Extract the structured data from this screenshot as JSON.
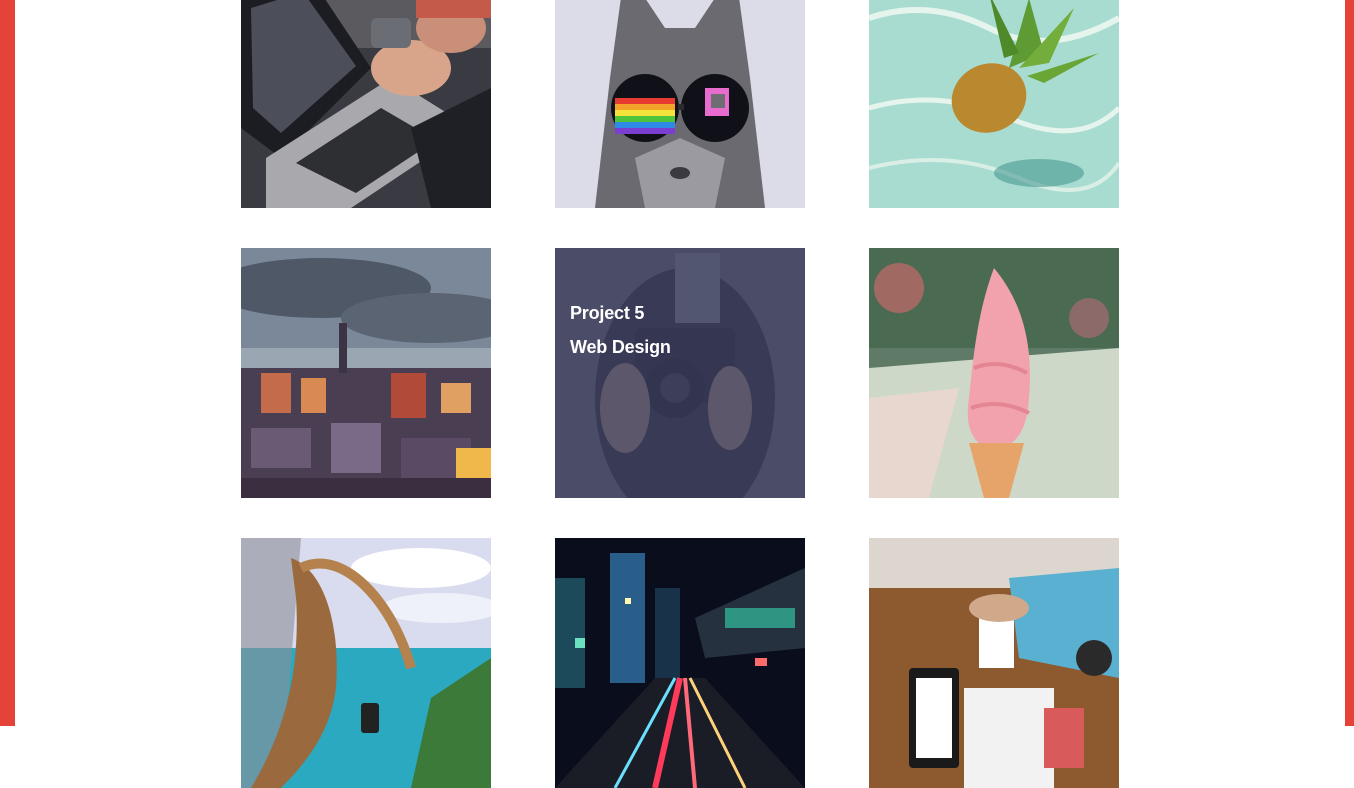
{
  "colors": {
    "frame": "#e5433a",
    "background": "#ffffff",
    "overlay": "#3e4060"
  },
  "portfolio": {
    "tiles": [
      {
        "subject": "laptop"
      },
      {
        "subject": "cat-with-sunglasses"
      },
      {
        "subject": "pineapple-in-water"
      },
      {
        "subject": "city-skyline"
      },
      {
        "subject": "person-with-camera",
        "hovered": true,
        "title": "Project 5",
        "category": "Web Design"
      },
      {
        "subject": "ice-cream-cone"
      },
      {
        "subject": "girl-at-fence-by-sea"
      },
      {
        "subject": "night-city-street"
      },
      {
        "subject": "desk-with-tablet"
      }
    ]
  }
}
